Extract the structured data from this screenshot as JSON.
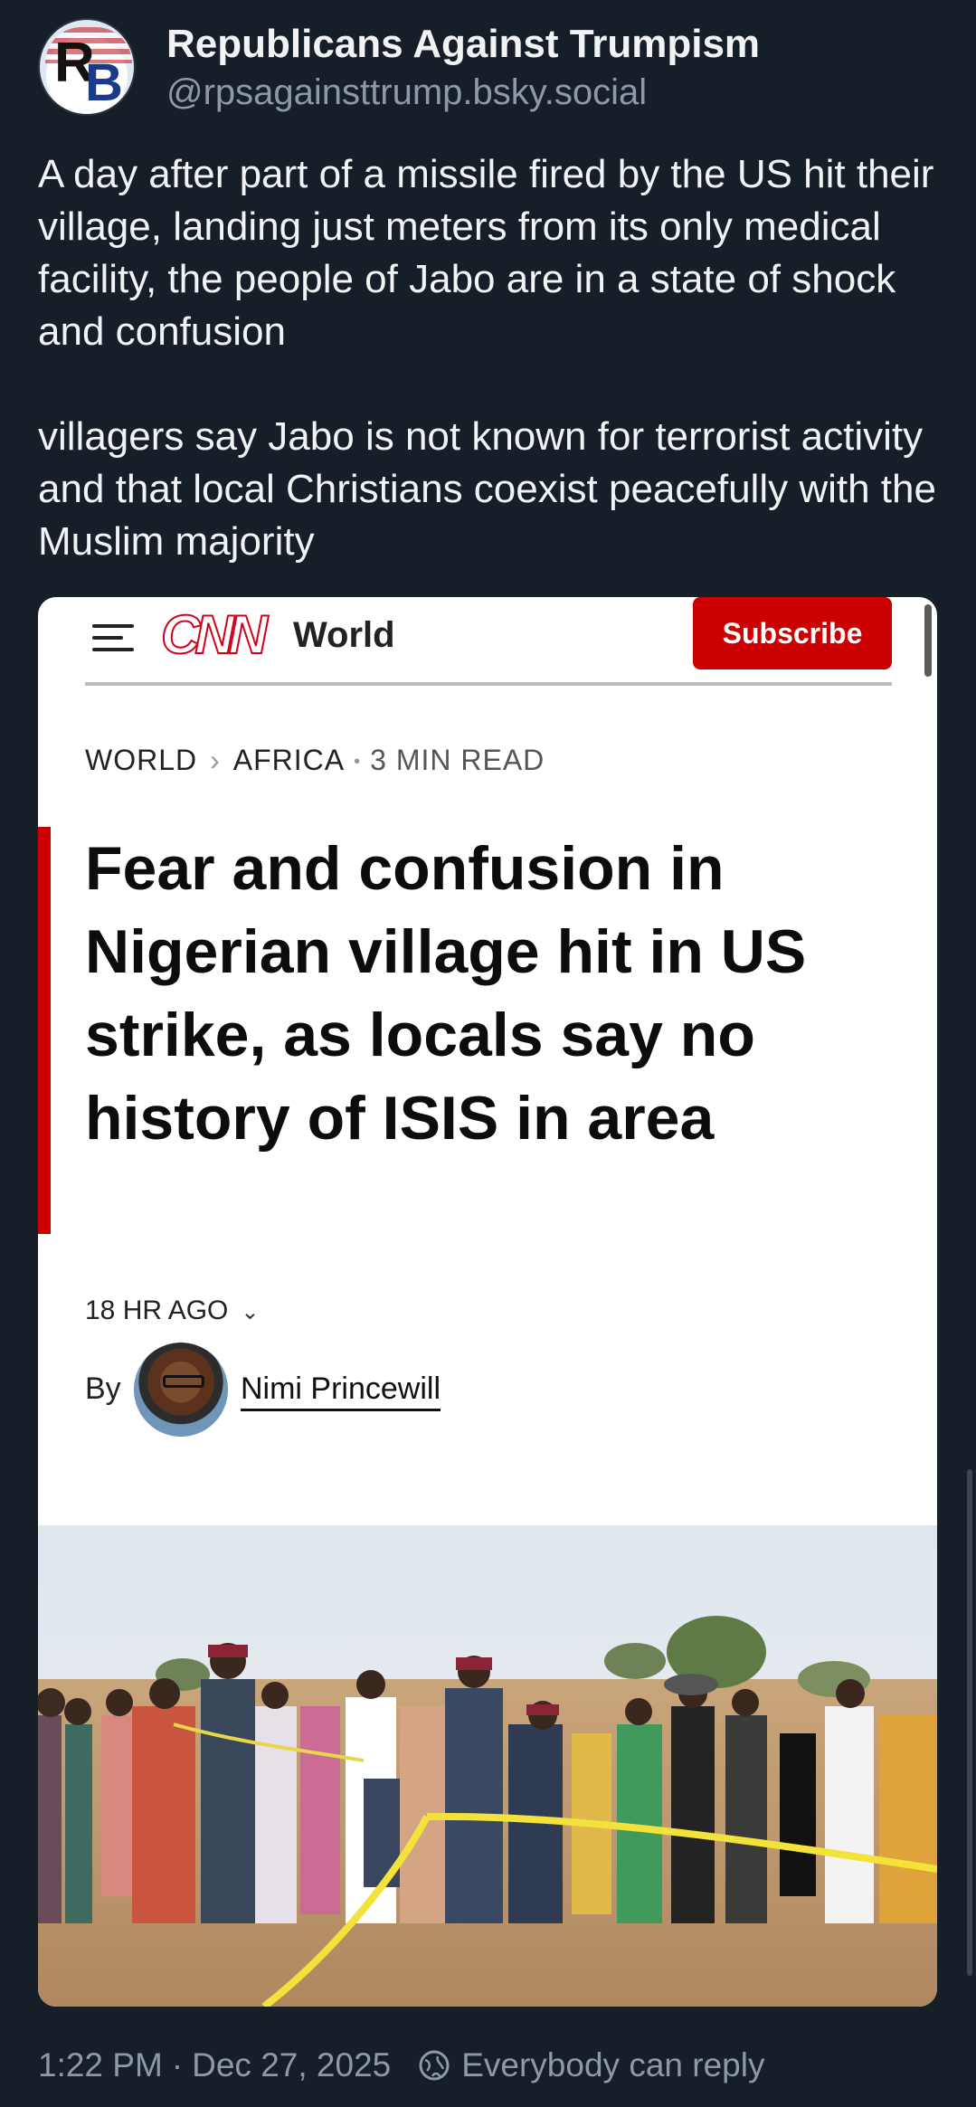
{
  "post": {
    "author": {
      "display_name": "Republicans Against Trumpism",
      "handle": "@rpsagainsttrump.bsky.social",
      "avatar_letters": [
        "R",
        "B"
      ]
    },
    "text": {
      "paragraph_1": "A day after part of a missile fired by the US hit their village, landing just meters from its only medical facility, the people of Jabo are in a state of shock and confusion",
      "paragraph_2": "villagers say Jabo is not known for terrorist activity and that local Christians coexist peacefully with the Muslim majority"
    },
    "footer": {
      "time": "1:22 PM",
      "separator": "·",
      "date": "Dec 27, 2025",
      "reply_setting": "Everybody can reply"
    }
  },
  "embed": {
    "site": {
      "logo_text": "CNN",
      "section": "World",
      "subscribe_label": "Subscribe"
    },
    "breadcrumb": {
      "section": "WORLD",
      "chevron": "›",
      "subsection": "AFRICA",
      "dot": "•",
      "read_time": "3 MIN READ"
    },
    "headline": "Fear and confusion in Nigerian village hit in US strike, as locals say no history of ISIS in area",
    "timestamp": "18 HR AGO",
    "byline": {
      "prefix": "By",
      "author": "Nimi Princewill"
    }
  },
  "colors": {
    "background": "#161e27",
    "text_primary": "#f1f3f5",
    "text_secondary": "#8d99a8",
    "cnn_red": "#cc0000"
  },
  "icons": {
    "menu": "hamburger-icon",
    "chevron": "chevron-down-icon",
    "reply": "globe-reply-icon"
  }
}
